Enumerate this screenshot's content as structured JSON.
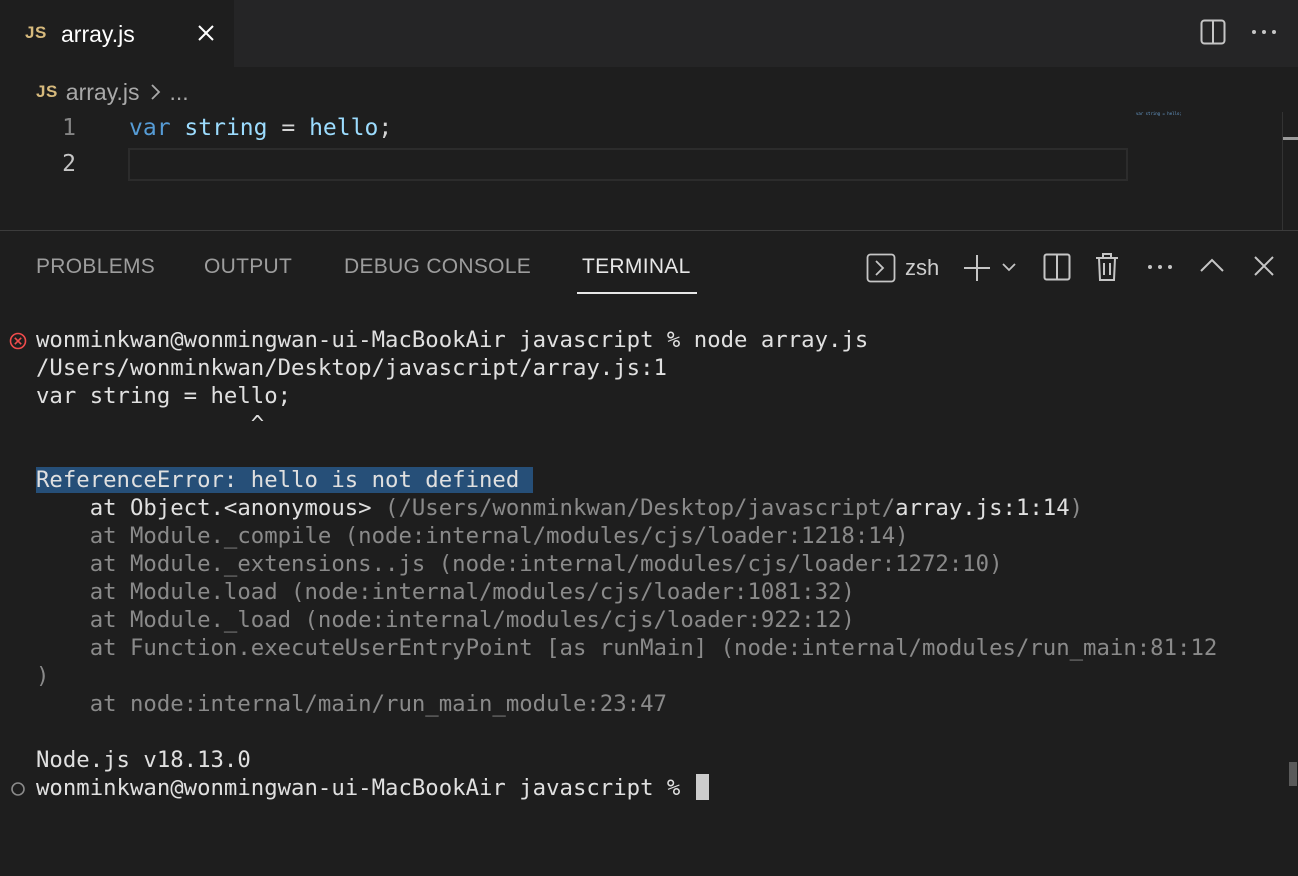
{
  "tab": {
    "badge": "JS",
    "title": "array.js"
  },
  "breadcrumb": {
    "badge": "JS",
    "file": "array.js",
    "more": "..."
  },
  "editor": {
    "lines": [
      {
        "number": "1",
        "tokens": {
          "kw": "var",
          "name": "string",
          "op": "=",
          "value": "hello",
          "end": ";"
        }
      },
      {
        "number": "2"
      }
    ],
    "minimap": "var string = hello;"
  },
  "panel": {
    "tabs": [
      "PROBLEMS",
      "OUTPUT",
      "DEBUG CONSOLE",
      "TERMINAL"
    ],
    "active_tab": "TERMINAL",
    "shell": "zsh"
  },
  "terminal": {
    "command_line": "wonminkwan@wonmingwan-ui-MacBookAir javascript % node array.js",
    "file_line": "/Users/wonminkwan/Desktop/javascript/array.js:1",
    "source_line": "var string = hello;",
    "caret_line": "                ^",
    "error": "ReferenceError: hello is not defined",
    "stack_first_prefix": "    at ",
    "stack_first_fn": "Object.<anonymous>",
    "stack_first_path": " (/Users/wonminkwan/Desktop/javascript/",
    "stack_first_loc": "array.js:1:14",
    "stack_first_end": ")",
    "stack": [
      "    at Module._compile (node:internal/modules/cjs/loader:1218:14)",
      "    at Module._extensions..js (node:internal/modules/cjs/loader:1272:10)",
      "    at Module.load (node:internal/modules/cjs/loader:1081:32)",
      "    at Module._load (node:internal/modules/cjs/loader:922:12)",
      "    at Function.executeUserEntryPoint [as runMain] (node:internal/modules/run_main:81:12",
      ")",
      "    at node:internal/main/run_main_module:23:47"
    ],
    "version": "Node.js v18.13.0",
    "prompt": "wonminkwan@wonmingwan-ui-MacBookAir javascript % "
  },
  "colors": {
    "keyword": "#569cd6",
    "variable": "#9cdcfe",
    "js_badge": "#d7ba7d",
    "error_icon": "#f14c4c",
    "selection": "#264f78"
  }
}
